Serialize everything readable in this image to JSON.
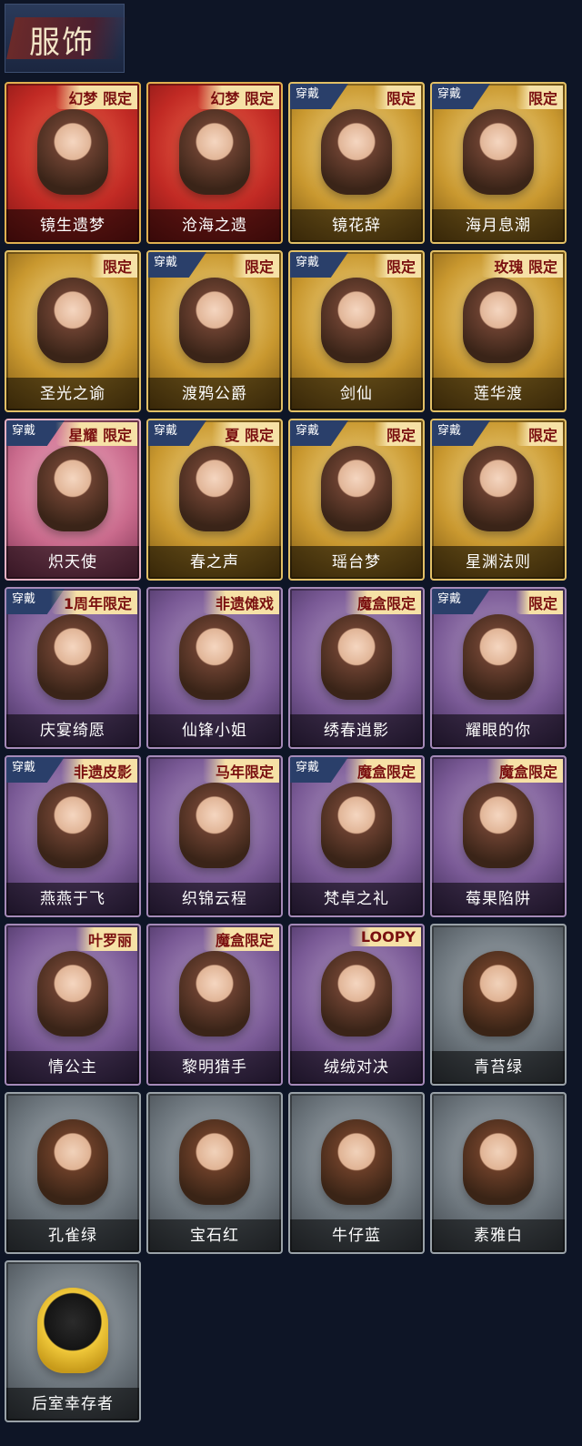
{
  "header": {
    "title": "服饰"
  },
  "cards": [
    {
      "name": "镜生遗梦",
      "tag": "幻梦 限定",
      "worn": false,
      "color": "red"
    },
    {
      "name": "沧海之遗",
      "tag": "幻梦 限定",
      "worn": false,
      "color": "red"
    },
    {
      "name": "镜花辞",
      "tag": "限定",
      "worn": true,
      "color": "gold"
    },
    {
      "name": "海月息潮",
      "tag": "限定",
      "worn": true,
      "color": "gold"
    },
    {
      "name": "圣光之谕",
      "tag": "限定",
      "worn": false,
      "color": "gold"
    },
    {
      "name": "渡鸦公爵",
      "tag": "限定",
      "worn": true,
      "color": "gold"
    },
    {
      "name": "剑仙",
      "tag": "限定",
      "worn": true,
      "color": "gold"
    },
    {
      "name": "莲华渡",
      "tag": "玫瑰 限定",
      "worn": false,
      "color": "gold"
    },
    {
      "name": "炽天使",
      "tag": "星耀 限定",
      "worn": true,
      "color": "pink"
    },
    {
      "name": "春之声",
      "tag": "夏 限定",
      "worn": true,
      "color": "gold"
    },
    {
      "name": "瑶台梦",
      "tag": "限定",
      "worn": true,
      "color": "gold"
    },
    {
      "name": "星渊法则",
      "tag": "限定",
      "worn": true,
      "color": "gold"
    },
    {
      "name": "庆宴绮愿",
      "tag": "1周年限定",
      "worn": true,
      "color": "purple"
    },
    {
      "name": "仙锋小姐",
      "tag": "非遗傩戏",
      "worn": false,
      "color": "purple"
    },
    {
      "name": "绣春逍影",
      "tag": "魔盒限定",
      "worn": false,
      "color": "purple"
    },
    {
      "name": "耀眼的你",
      "tag": "限定",
      "worn": true,
      "color": "purple"
    },
    {
      "name": "燕燕于飞",
      "tag": "非遗皮影",
      "worn": true,
      "color": "purple"
    },
    {
      "name": "织锦云程",
      "tag": "马年限定",
      "worn": false,
      "color": "purple"
    },
    {
      "name": "梵卓之礼",
      "tag": "魔盒限定",
      "worn": true,
      "color": "purple"
    },
    {
      "name": "莓果陷阱",
      "tag": "魔盒限定",
      "worn": false,
      "color": "purple"
    },
    {
      "name": "情公主",
      "tag": "叶罗丽",
      "worn": false,
      "color": "purple"
    },
    {
      "name": "黎明猎手",
      "tag": "魔盒限定",
      "worn": false,
      "color": "purple"
    },
    {
      "name": "绒绒对决",
      "tag": "LOOPY",
      "worn": false,
      "color": "purple"
    },
    {
      "name": "青苔绿",
      "tag": "",
      "worn": false,
      "color": "grey"
    },
    {
      "name": "孔雀绿",
      "tag": "",
      "worn": false,
      "color": "grey"
    },
    {
      "name": "宝石红",
      "tag": "",
      "worn": false,
      "color": "grey"
    },
    {
      "name": "牛仔蓝",
      "tag": "",
      "worn": false,
      "color": "grey"
    },
    {
      "name": "素雅白",
      "tag": "",
      "worn": false,
      "color": "grey"
    },
    {
      "name": "后室幸存者",
      "tag": "",
      "worn": false,
      "color": "grey"
    }
  ],
  "labels": {
    "worn_label": "穿戴"
  }
}
